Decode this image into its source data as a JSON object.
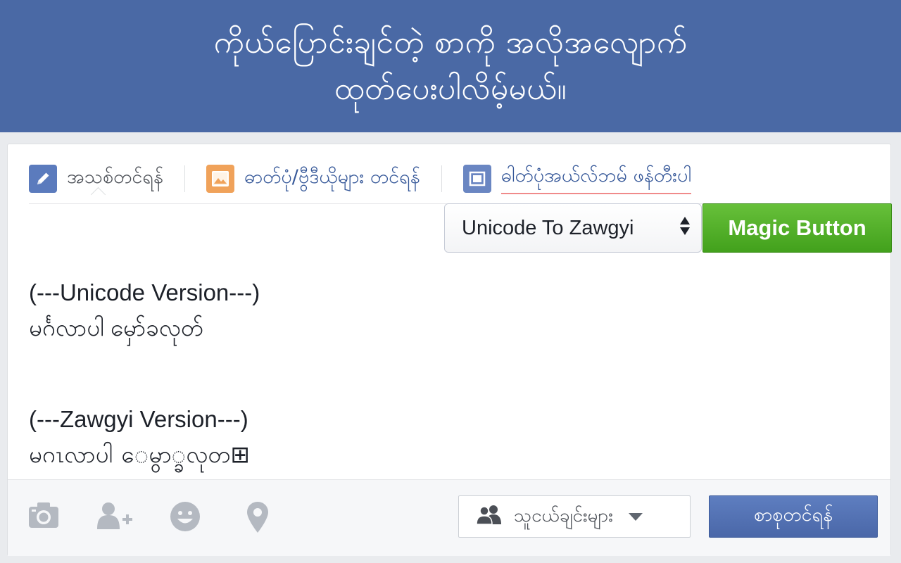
{
  "banner": {
    "line1": "ကိုယ်ပြောင်းချင်တဲ့ စာကို အလိုအလျောက်",
    "line2": "ထုတ်ပေးပါလိမ့်မယ်။"
  },
  "tabs": [
    {
      "label": "အသစ်တင်ရန်",
      "icon": "pencil-icon"
    },
    {
      "label": "ဓာတ်ပုံ/ဗွီဒီယိုများ တင်ရန်",
      "icon": "photo-icon"
    },
    {
      "label": "ဓါတ်ပုံအယ်လ်ဘမ် ဖန်တီးပါ",
      "icon": "album-icon"
    }
  ],
  "converter": {
    "selected": "Unicode To Zawgyi",
    "button_label": "Magic Button"
  },
  "composer": {
    "unicode_heading": "(---Unicode Version---)",
    "unicode_text": "မင်္ဂလာပါ မှော်ခလုတ်",
    "zawgyi_heading": "(---Zawgyi Version---)",
    "zawgyi_text": "မဂၤလာပါ ေမွာ္ခလုတ⊞"
  },
  "footer": {
    "icons": [
      "camera-icon",
      "tag-friend-icon",
      "emoji-icon",
      "location-icon"
    ],
    "audience_label": "သူငယ်ချင်းများ",
    "post_label": "စာစုတင်ရန်"
  },
  "colors": {
    "banner": "#4a69a5",
    "magic_button": "#4ab020",
    "post_button": "#4f6eb0",
    "link_text": "#365899"
  }
}
